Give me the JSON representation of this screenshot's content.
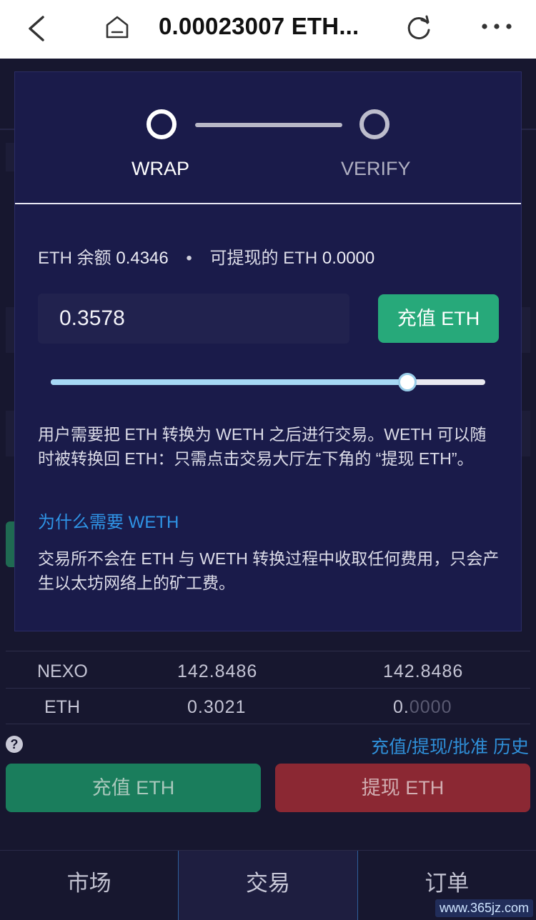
{
  "topbar": {
    "title": "0.00023007 ETH..."
  },
  "modal": {
    "steps": [
      {
        "label": "WRAP",
        "state": "active"
      },
      {
        "label": "VERIFY",
        "state": "pending"
      }
    ],
    "balance": {
      "eth_label": "ETH 余额",
      "eth_value": "0.4346",
      "separator": "•",
      "withdrawable_label": "可提现的 ETH",
      "withdrawable_value": "0.0000"
    },
    "amount_value": "0.3578",
    "charge_button": "充值 ETH",
    "slider_fraction": 0.82,
    "description1": "用户需要把 ETH 转换为 WETH 之后进行交易。WETH 可以随时被转换回 ETH：只需点击交易大厅左下角的 “提现 ETH”。",
    "why_link": "为什么需要 WETH",
    "description2": "交易所不会在 ETH 与 WETH 转换过程中收取任何费用，只会产生以太坊网络上的矿工费。"
  },
  "background": {
    "rows": [
      {
        "coin": "NEXO",
        "balance": "142.8486",
        "available": "142.8486",
        "available_dim": ""
      },
      {
        "coin": "ETH",
        "balance": "0.3021",
        "available": "0.",
        "available_dim": "0000"
      }
    ],
    "links": "充值/提现/批准  历史",
    "deposit_button": "充值 ETH",
    "withdraw_button": "提现 ETH"
  },
  "bottom_nav": {
    "tabs": [
      "市场",
      "交易",
      "订单"
    ],
    "active": 1
  },
  "watermark": "www.365jz.com"
}
